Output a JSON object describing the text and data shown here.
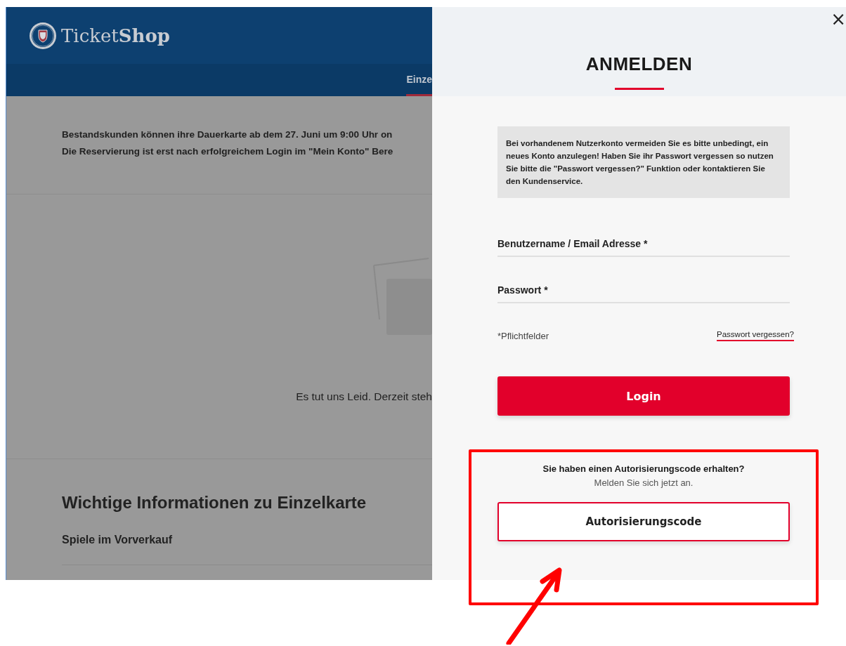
{
  "header": {
    "logo_text": "Ticket",
    "logo_text_bold": "Shop"
  },
  "nav": {
    "items": [
      {
        "label": "Einze",
        "selected": true
      }
    ]
  },
  "notice": {
    "lines": [
      "Bestandskunden können ihre Dauerkarte ab dem 27. Juni um 9:00 Uhr on",
      "Die Reservierung ist erst nach erfolgreichem Login im \"Mein Konto\" Bere"
    ]
  },
  "empty_state": {
    "message": "Es tut uns Leid. Derzeit steh"
  },
  "info": {
    "heading": "Wichtige Informationen zu Einzelkarte",
    "subheading": "Spiele im Vorverkauf"
  },
  "login_panel": {
    "title": "ANMELDEN",
    "close": "×",
    "hint": "Bei vorhandenem Nutzerkonto vermeiden Sie es bitte unbedingt, ein neues Konto anzulegen! Haben Sie ihr Passwort vergessen so nutzen Sie bitte die \"Passwort vergessen?\" Funktion oder kontaktieren Sie den Kundenservice.",
    "fields": [
      {
        "placeholder": "Benutzername / Email Adresse *"
      },
      {
        "placeholder": "Passwort *"
      }
    ],
    "required_note": "*Pflichtfelder",
    "forgot_link": "Passwort vergessen?",
    "login_button": "Login",
    "auth_question": "Sie haben einen Autorisierungscode erhalten?",
    "auth_sub": "Melden Sie sich jetzt an.",
    "auth_button": "Autorisierungscode"
  }
}
